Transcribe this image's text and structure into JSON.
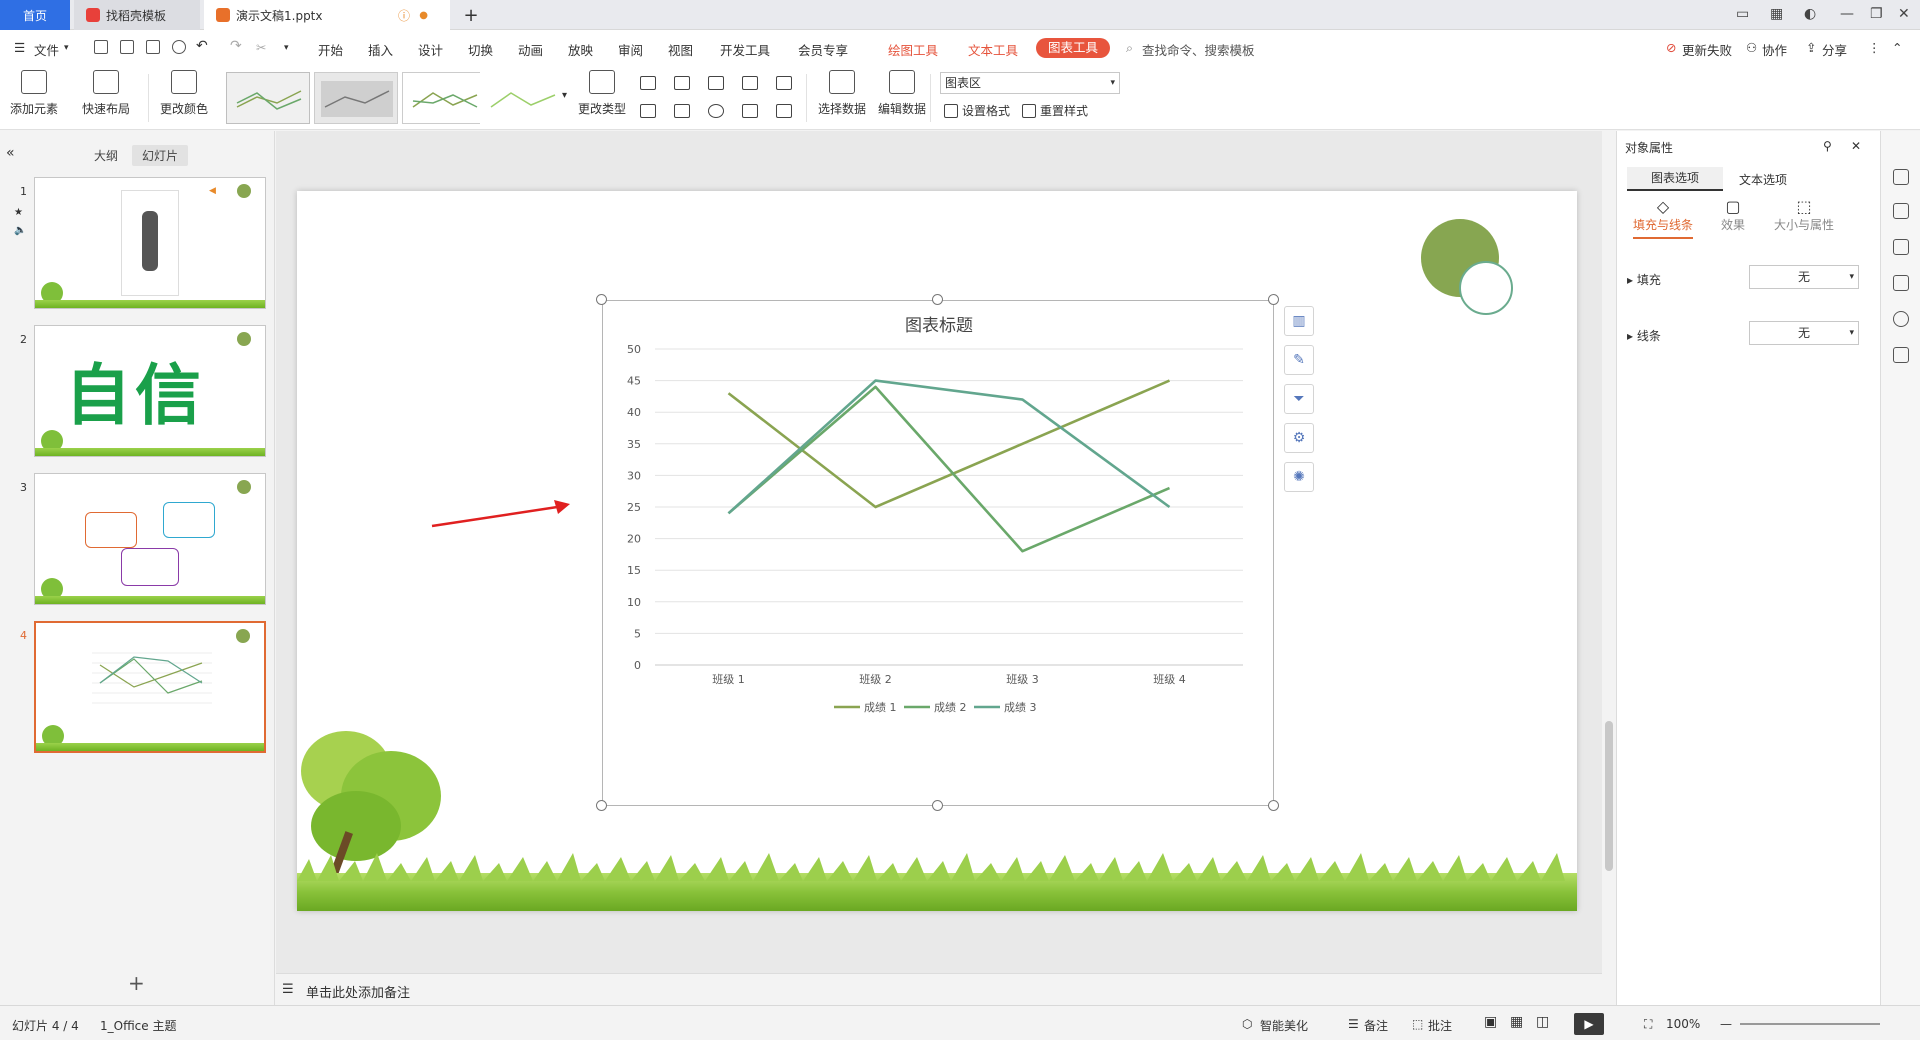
{
  "titlebar": {
    "tabs": [
      {
        "label": "首页"
      },
      {
        "label": "找稻壳模板"
      },
      {
        "label": "演示文稿1.pptx"
      }
    ],
    "new_tab": "+"
  },
  "menubar": {
    "file": "文件",
    "items": [
      "开始",
      "插入",
      "设计",
      "切换",
      "动画",
      "放映",
      "审阅",
      "视图",
      "开发工具",
      "会员专享"
    ],
    "context_tabs": [
      "绘图工具",
      "文本工具"
    ],
    "active_tab": "图表工具",
    "search_placeholder": "查找命令、搜索模板",
    "right": {
      "update": "更新失败",
      "collab": "协作",
      "share": "分享"
    }
  },
  "ribbon": {
    "add_element": "添加元素",
    "quick_layout": "快速布局",
    "change_color": "更改颜色",
    "change_type": "更改类型",
    "select_data": "选择数据",
    "edit_data": "编辑数据",
    "area_select": "图表区",
    "set_format": "设置格式",
    "reset_style": "重置样式"
  },
  "leftpanel": {
    "tab_outline": "大纲",
    "tab_slides": "幻灯片",
    "thumbs": [
      {
        "num": "1"
      },
      {
        "num": "2",
        "text": "自信"
      },
      {
        "num": "3"
      },
      {
        "num": "4"
      }
    ],
    "add": "+"
  },
  "chart_data": {
    "type": "line",
    "title": "图表标题",
    "categories": [
      "班级 1",
      "班级 2",
      "班级 3",
      "班级 4"
    ],
    "series": [
      {
        "name": "成绩 1",
        "values": [
          43,
          25,
          35,
          45
        ],
        "color": "#8aa451"
      },
      {
        "name": "成绩 2",
        "values": [
          24,
          44,
          18,
          28
        ],
        "color": "#6aa86a"
      },
      {
        "name": "成绩 3",
        "values": [
          24,
          45,
          42,
          25
        ],
        "color": "#62a68e"
      }
    ],
    "ylim": [
      0,
      50
    ],
    "yticks": [
      "0",
      "5",
      "10",
      "15",
      "20",
      "25",
      "30",
      "35",
      "40",
      "45",
      "50"
    ],
    "grid": true,
    "legend_position": "bottom"
  },
  "notes": "单击此处添加备注",
  "rightpanel": {
    "header": "对象属性",
    "tab_chart": "图表选项",
    "tab_text": "文本选项",
    "sub_fill": "填充与线条",
    "sub_effect": "效果",
    "sub_size": "大小与属性",
    "fill_label": "填充",
    "fill_value": "无",
    "line_label": "线条",
    "line_value": "无"
  },
  "statusbar": {
    "slide_info": "幻灯片 4 / 4",
    "theme": "1_Office 主题",
    "smart": "智能美化",
    "notes": "备注",
    "comment": "批注",
    "zoom": "100%"
  },
  "colors": {
    "accent": "#e8553d",
    "home_tab": "#2f6fe4",
    "selection": "#e06a33"
  }
}
